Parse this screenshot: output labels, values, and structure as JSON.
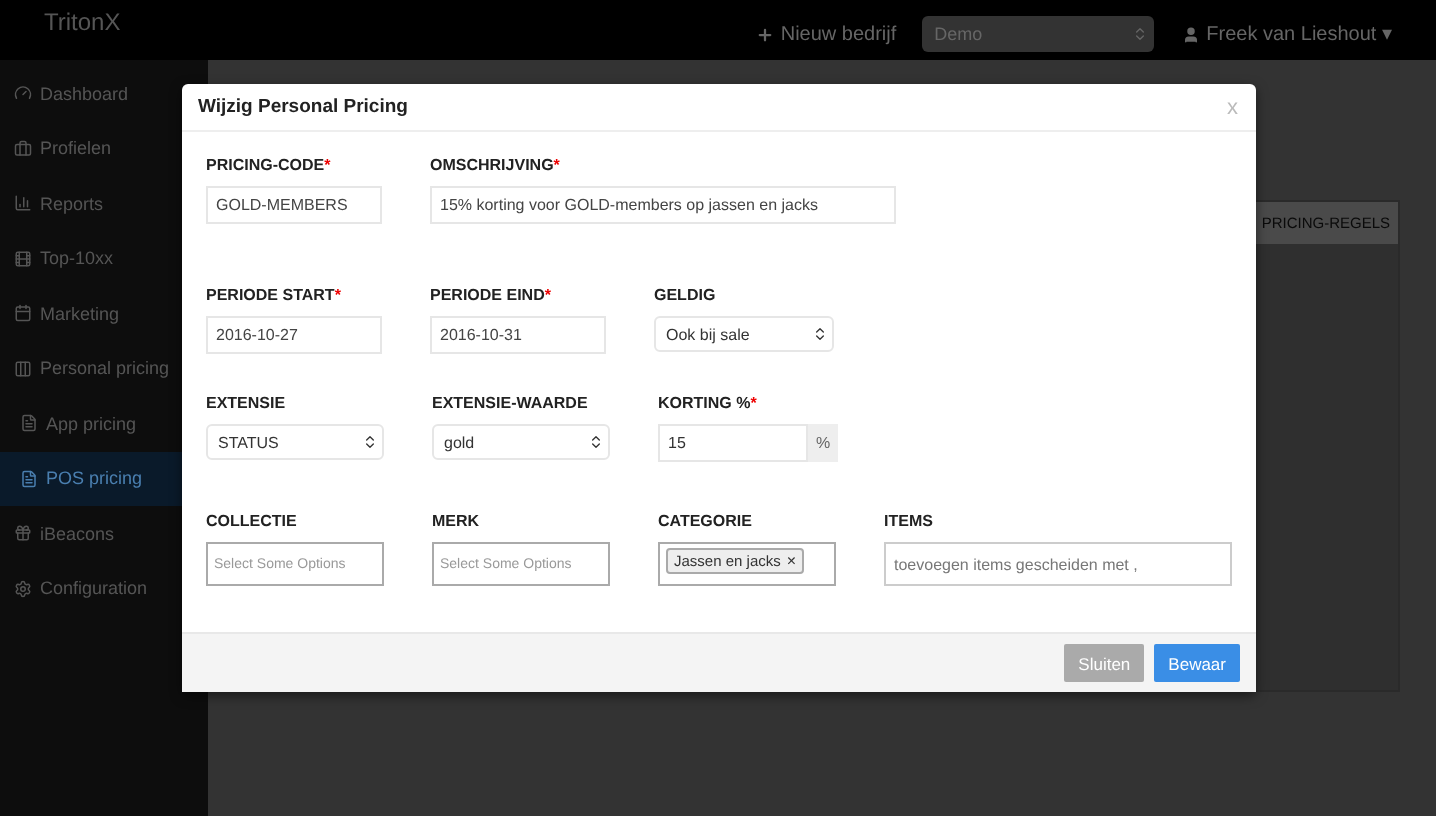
{
  "topbar": {
    "brand": "TritonX",
    "new_company": "Nieuw bedrijf",
    "company_select": "Demo",
    "user": "Freek van Lieshout",
    "user_caret": "▾"
  },
  "sidebar": {
    "items": [
      {
        "label": "Dashboard",
        "selected": false
      },
      {
        "label": "Profielen",
        "selected": false
      },
      {
        "label": "Reports",
        "selected": false
      },
      {
        "label": "Top-10xx",
        "selected": false
      },
      {
        "label": "Marketing",
        "selected": false
      },
      {
        "label": "Personal pricing",
        "selected": false,
        "children": [
          {
            "label": "App pricing",
            "selected": false
          },
          {
            "label": "POS pricing",
            "selected": true
          }
        ]
      },
      {
        "label": "iBeacons",
        "selected": false
      },
      {
        "label": "Configuration",
        "selected": false
      }
    ]
  },
  "panel": {
    "tab": "PRICING-REGELS"
  },
  "modal": {
    "title": "Wijzig Personal Pricing",
    "close": "x",
    "rows": [
      [
        {
          "kind": "text",
          "label": "PRICING-CODE",
          "required_mark": "*",
          "value": "GOLD-MEMBERS"
        },
        {
          "kind": "text",
          "label": "OMSCHRIJVING",
          "required_mark": "*",
          "value": "15% korting voor GOLD-members op jassen en jacks"
        }
      ],
      [
        {
          "kind": "text",
          "label": "PERIODE START",
          "required_mark": "*",
          "value": "2016-10-27"
        },
        {
          "kind": "text",
          "label": "PERIODE EIND",
          "required_mark": "*",
          "value": "2016-10-31"
        },
        {
          "kind": "select",
          "label": "GELDIG",
          "value": "Ook bij sale"
        }
      ],
      [
        {
          "kind": "select",
          "label": "EXTENSIE",
          "value": "STATUS"
        },
        {
          "kind": "select",
          "label": "EXTENSIE-WAARDE",
          "value": "gold"
        },
        {
          "kind": "addon",
          "label": "KORTING %",
          "required_mark": "*",
          "value": "15",
          "addon": "%"
        }
      ],
      [
        {
          "kind": "multiselect",
          "label": "COLLECTIE",
          "placeholder": "Select Some Options"
        },
        {
          "kind": "multiselect",
          "label": "MERK",
          "placeholder": "Select Some Options"
        },
        {
          "kind": "tags",
          "label": "CATEGORIE",
          "tags": [
            {
              "label": "Jassen en jacks",
              "remove": "×"
            }
          ]
        },
        {
          "kind": "items",
          "label": "ITEMS",
          "placeholder": "toevoegen items gescheiden met ,"
        }
      ]
    ],
    "buttons": [
      {
        "label": "Sluiten",
        "kind": "secondary"
      },
      {
        "label": "Bewaar",
        "kind": "primary"
      }
    ]
  }
}
